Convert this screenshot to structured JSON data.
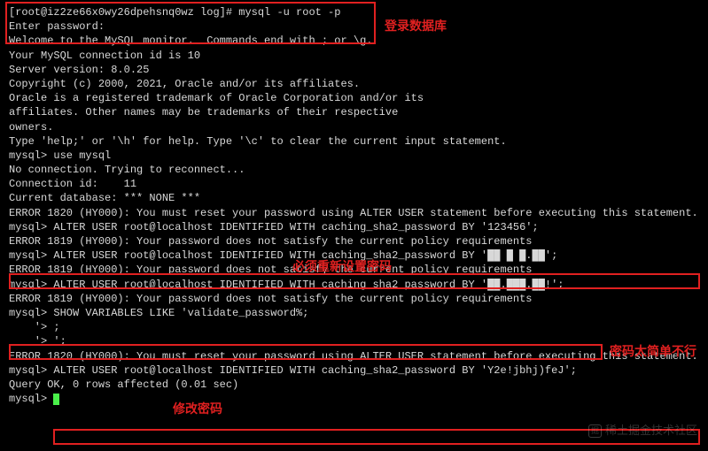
{
  "lines": {
    "l0": "[root@iz2ze66x0wy26dpehsnq0wz log]# mysql -u root -p",
    "l1": "Enter password:",
    "l2": "Welcome to the MySQL monitor.  Commands end with ; or \\g.",
    "l3": "Your MySQL connection id is 10",
    "l4": "Server version: 8.0.25",
    "l5": "",
    "l6": "Copyright (c) 2000, 2021, Oracle and/or its affiliates.",
    "l7": "",
    "l8": "Oracle is a registered trademark of Oracle Corporation and/or its",
    "l9": "affiliates. Other names may be trademarks of their respective",
    "l10": "owners.",
    "l11": "",
    "l12": "Type 'help;' or '\\h' for help. Type '\\c' to clear the current input statement.",
    "l13": "",
    "l14": "mysql> use mysql",
    "l15": "No connection. Trying to reconnect...",
    "l16": "Connection id:    11",
    "l17": "Current database: *** NONE ***",
    "l18": "",
    "l19": "ERROR 1820 (HY000): You must reset your password using ALTER USER statement before executing this statement.",
    "l20": "mysql> ALTER USER root@localhost IDENTIFIED WITH caching_sha2_password BY '123456';",
    "l21": "ERROR 1819 (HY000): Your password does not satisfy the current policy requirements",
    "l22": "mysql> ALTER USER root@localhost IDENTIFIED WITH caching_sha2_password BY '██ █ █.██';",
    "l23": "ERROR 1819 (HY000): Your password does not satisfy the current policy requirements",
    "l24": "mysql> ALTER USER root@localhost IDENTIFIED WITH caching_sha2_password BY '██.███.██!';",
    "l25": "ERROR 1819 (HY000): Your password does not satisfy the current policy requirements",
    "l26": "mysql> SHOW VARIABLES LIKE 'validate_password%;",
    "l27": "    '> ;",
    "l28": "    '> ';",
    "l29": "ERROR 1820 (HY000): You must reset your password using ALTER USER statement before executing this statement.",
    "l30": "mysql> ALTER USER root@localhost IDENTIFIED WITH caching_sha2_password BY 'Y2e!jbhj)feJ';",
    "l31": "Query OK, 0 rows affected (0.01 sec)",
    "l32": "",
    "l33": "mysql> "
  },
  "annotations": {
    "a1": "登录数据库",
    "a2": "必须重新设置密码",
    "a3": "密码太简单不行",
    "a4": "修改密码"
  },
  "watermark": "稀土掘金技术社区",
  "watermark_icon": "掘"
}
